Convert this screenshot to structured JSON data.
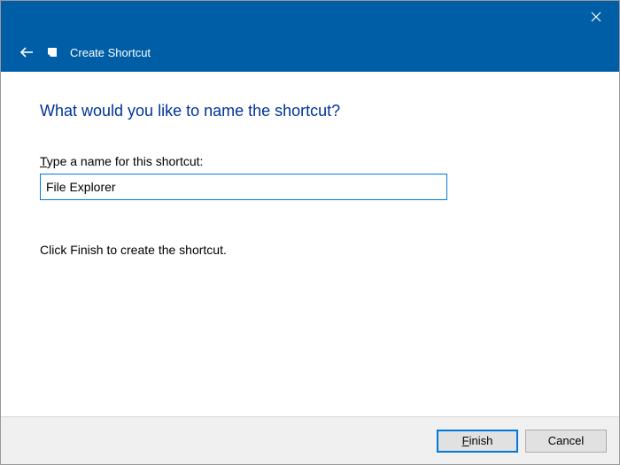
{
  "titlebar": {
    "close_icon": "close"
  },
  "header": {
    "back_icon": "back",
    "app_icon": "shortcut",
    "title": "Create Shortcut"
  },
  "content": {
    "heading": "What would you like to name the shortcut?",
    "name_label": "Type a name for this shortcut:",
    "name_value": "File Explorer",
    "instruction": "Click Finish to create the shortcut."
  },
  "footer": {
    "finish_label": "Finish",
    "cancel_label": "Cancel"
  }
}
